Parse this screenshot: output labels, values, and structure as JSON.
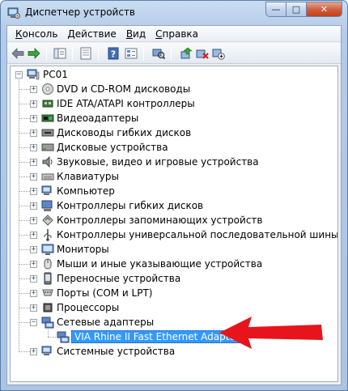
{
  "window": {
    "title": "Диспетчер устройств",
    "controls": {
      "minimize": "—",
      "maximize": "□",
      "close": "✕"
    }
  },
  "menu": [
    {
      "underline": "К",
      "rest": "онсоль"
    },
    {
      "underline": "Д",
      "rest": "ействие"
    },
    {
      "underline": "В",
      "rest": "ид"
    },
    {
      "underline": "С",
      "rest": "правка"
    }
  ],
  "toolbar": {
    "icons": [
      "back-arrow-icon",
      "forward-arrow-icon",
      "show-hide-tree-icon",
      "properties-icon",
      "help-icon",
      "view-icon",
      "scan-hardware-icon",
      "update-driver-icon",
      "uninstall-icon",
      "disable-icon"
    ]
  },
  "tree": {
    "root": "PC01",
    "categories": [
      {
        "label": "DVD и CD-ROM дисководы",
        "icon": "dvd-drive-icon"
      },
      {
        "label": "IDE ATA/ATAPI контроллеры",
        "icon": "ide-controller-icon"
      },
      {
        "label": "Видеоадаптеры",
        "icon": "display-adapter-icon"
      },
      {
        "label": "Дисководы гибких дисков",
        "icon": "floppy-drive-icon"
      },
      {
        "label": "Дисковые устройства",
        "icon": "disk-drive-icon"
      },
      {
        "label": "Звуковые, видео и игровые устройства",
        "icon": "sound-icon"
      },
      {
        "label": "Клавиатуры",
        "icon": "keyboard-icon"
      },
      {
        "label": "Компьютер",
        "icon": "computer-icon"
      },
      {
        "label": "Контроллеры гибких дисков",
        "icon": "floppy-controller-icon"
      },
      {
        "label": "Контроллеры запоминающих устройств",
        "icon": "storage-controller-icon"
      },
      {
        "label": "Контроллеры универсальной последовательной шины USB",
        "icon": "usb-icon"
      },
      {
        "label": "Мониторы",
        "icon": "monitor-icon"
      },
      {
        "label": "Мыши и иные указывающие устройства",
        "icon": "mouse-icon"
      },
      {
        "label": "Переносные устройства",
        "icon": "portable-device-icon"
      },
      {
        "label": "Порты (COM и LPT)",
        "icon": "port-icon"
      },
      {
        "label": "Процессоры",
        "icon": "processor-icon"
      },
      {
        "label": "Сетевые адаптеры",
        "icon": "network-adapter-icon",
        "expanded": true
      },
      {
        "label": "Системные устройства",
        "icon": "system-device-icon"
      }
    ],
    "selected_child": "VIA Rhine II Fast Ethernet Adapter",
    "expander_collapsed": "+",
    "expander_expanded": "−"
  },
  "colors": {
    "selection": "#3399ff",
    "arrow": "#e8141b"
  }
}
